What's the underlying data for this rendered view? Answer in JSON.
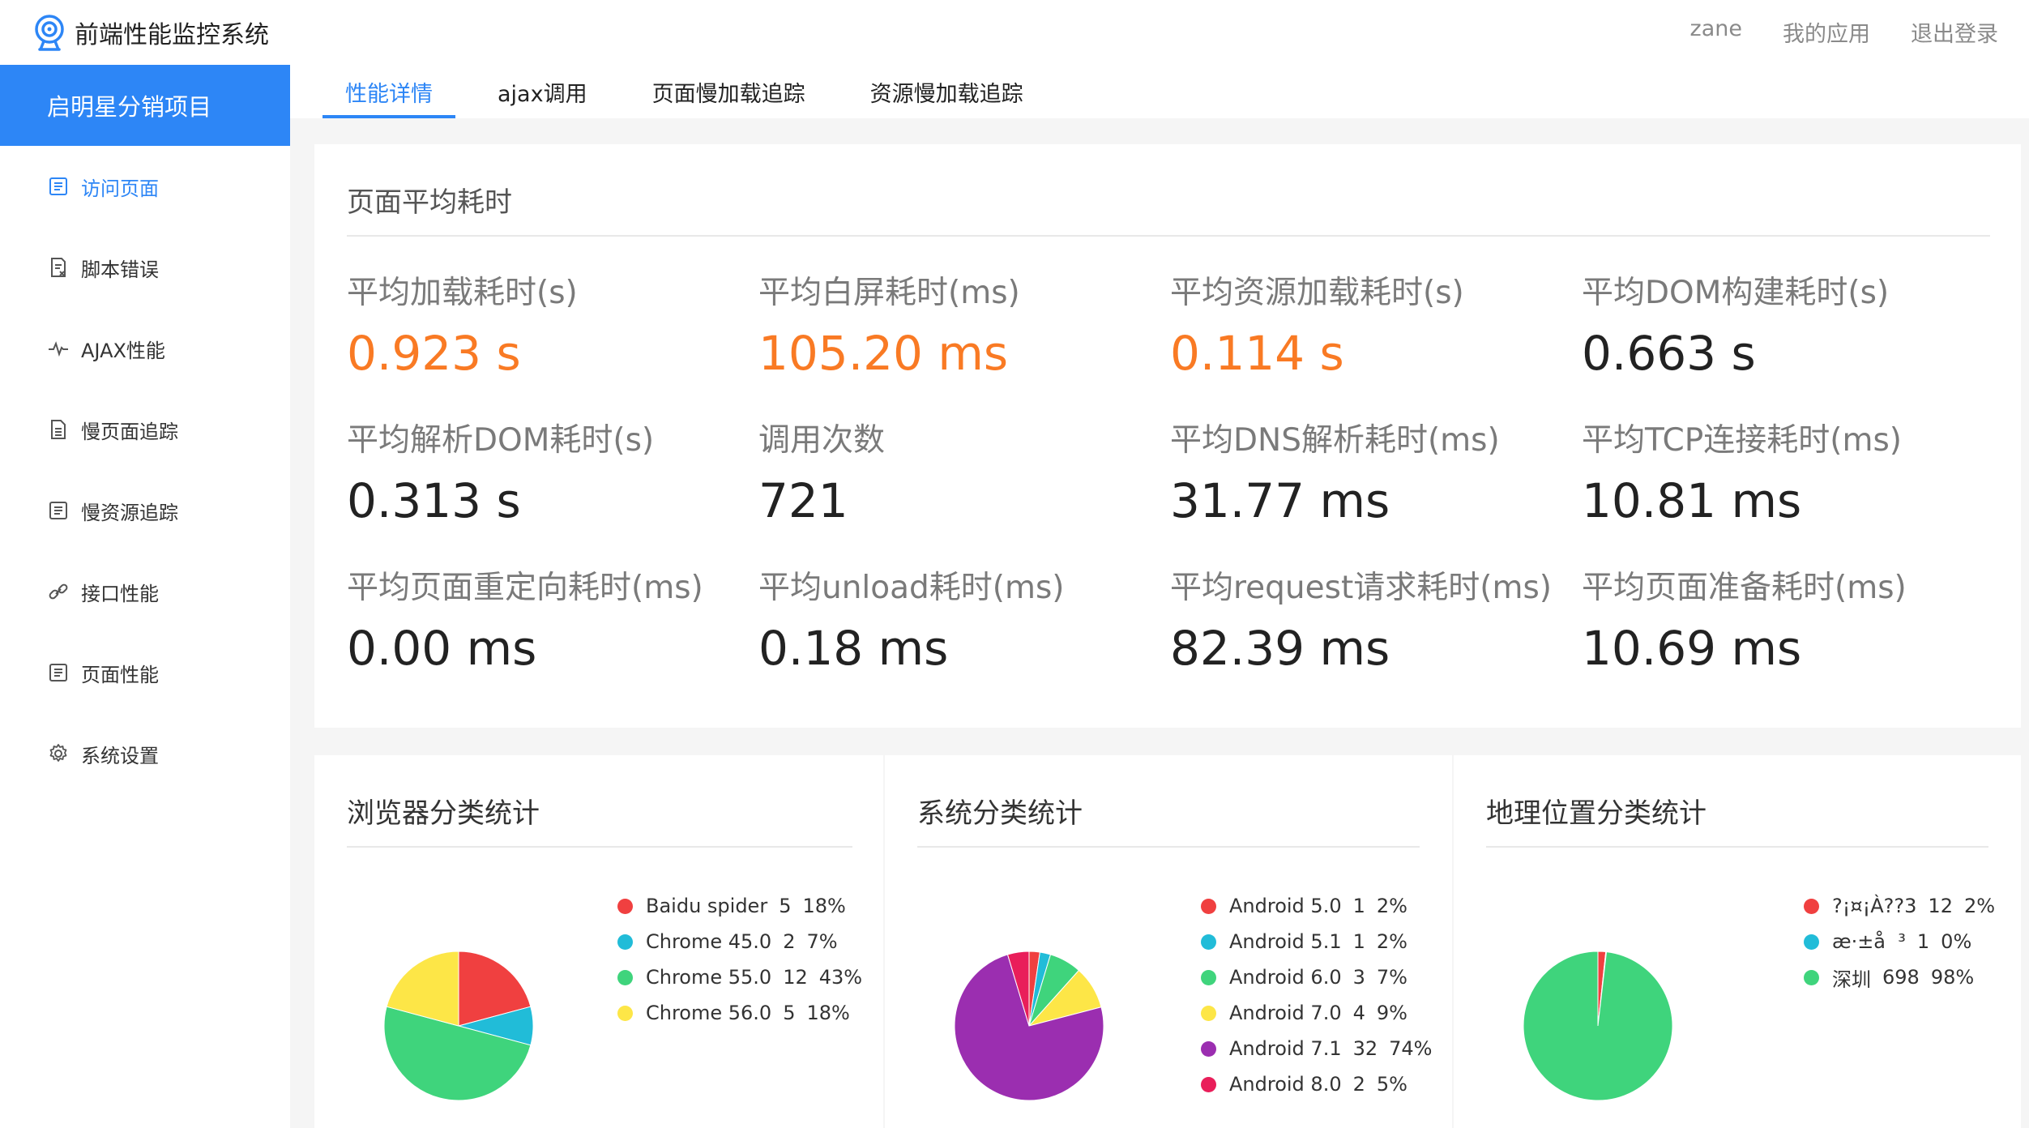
{
  "header": {
    "title": "前端性能监控系统",
    "user": "zane",
    "my_apps": "我的应用",
    "logout": "退出登录"
  },
  "sidebar": {
    "project": "启明星分销项目",
    "items": [
      {
        "label": "访问页面",
        "icon": "document-list-icon"
      },
      {
        "label": "脚本错误",
        "icon": "error-script-icon"
      },
      {
        "label": "AJAX性能",
        "icon": "pulse-icon"
      },
      {
        "label": "慢页面追踪",
        "icon": "page-icon"
      },
      {
        "label": "慢资源追踪",
        "icon": "document-list-icon"
      },
      {
        "label": "接口性能",
        "icon": "link-icon"
      },
      {
        "label": "页面性能",
        "icon": "document-list-icon"
      },
      {
        "label": "系统设置",
        "icon": "gear-icon"
      }
    ]
  },
  "tabs": [
    "性能详情",
    "ajax调用",
    "页面慢加载追踪",
    "资源慢加载追踪"
  ],
  "perf": {
    "title": "页面平均耗时",
    "metrics": [
      {
        "label": "平均加载耗时(s)",
        "value": "0.923 s",
        "highlight": true
      },
      {
        "label": "平均白屏耗时(ms)",
        "value": "105.20 ms",
        "highlight": true
      },
      {
        "label": "平均资源加载耗时(s)",
        "value": "0.114 s",
        "highlight": true
      },
      {
        "label": "平均DOM构建耗时(s)",
        "value": "0.663 s",
        "highlight": false
      },
      {
        "label": "平均解析DOM耗时(s)",
        "value": "0.313 s",
        "highlight": false
      },
      {
        "label": "调用次数",
        "value": "721",
        "highlight": false
      },
      {
        "label": "平均DNS解析耗时(ms)",
        "value": "31.77 ms",
        "highlight": false
      },
      {
        "label": "平均TCP连接耗时(ms)",
        "value": "10.81 ms",
        "highlight": false
      },
      {
        "label": "平均页面重定向耗时(ms)",
        "value": "0.00 ms",
        "highlight": false
      },
      {
        "label": "平均unload耗时(ms)",
        "value": "0.18 ms",
        "highlight": false
      },
      {
        "label": "平均request请求耗时(ms)",
        "value": "82.39 ms",
        "highlight": false
      },
      {
        "label": "平均页面准备耗时(ms)",
        "value": "10.69 ms",
        "highlight": false
      }
    ]
  },
  "colors": {
    "accent": "#2d86f6",
    "highlight": "#f97a24"
  },
  "chart_data": [
    {
      "type": "pie",
      "title": "浏览器分类统计",
      "slices": [
        {
          "label": "Baidu spider",
          "count": 5,
          "percent": "18%",
          "value": 5,
          "color": "#f04040"
        },
        {
          "label": "Chrome 45.0",
          "count": 2,
          "percent": "7%",
          "value": 2,
          "color": "#21bcd8"
        },
        {
          "label": "Chrome 55.0",
          "count": 12,
          "percent": "43%",
          "value": 12,
          "color": "#3fd47c"
        },
        {
          "label": "Chrome 56.0",
          "count": 5,
          "percent": "18%",
          "value": 5,
          "color": "#fde647"
        }
      ]
    },
    {
      "type": "pie",
      "title": "系统分类统计",
      "slices": [
        {
          "label": "Android 5.0",
          "count": 1,
          "percent": "2%",
          "value": 1,
          "color": "#f04040"
        },
        {
          "label": "Android 5.1",
          "count": 1,
          "percent": "2%",
          "value": 1,
          "color": "#21bcd8"
        },
        {
          "label": "Android 6.0",
          "count": 3,
          "percent": "7%",
          "value": 3,
          "color": "#3fd47c"
        },
        {
          "label": "Android 7.0",
          "count": 4,
          "percent": "9%",
          "value": 4,
          "color": "#fde647"
        },
        {
          "label": "Android 7.1",
          "count": 32,
          "percent": "74%",
          "value": 32,
          "color": "#9b2eb0"
        },
        {
          "label": "Android 8.0",
          "count": 2,
          "percent": "5%",
          "value": 2,
          "color": "#e91e5a"
        }
      ]
    },
    {
      "type": "pie",
      "title": "地理位置分类统计",
      "slices": [
        {
          "label": "?¡¤¡À??3",
          "count": 12,
          "percent": "2%",
          "value": 12,
          "color": "#f04040"
        },
        {
          "label": "æ·±å  ³",
          "count": 1,
          "percent": "0%",
          "value": 1,
          "color": "#21bcd8"
        },
        {
          "label": "深圳",
          "count": 698,
          "percent": "98%",
          "value": 698,
          "color": "#3fd47c"
        }
      ]
    }
  ]
}
